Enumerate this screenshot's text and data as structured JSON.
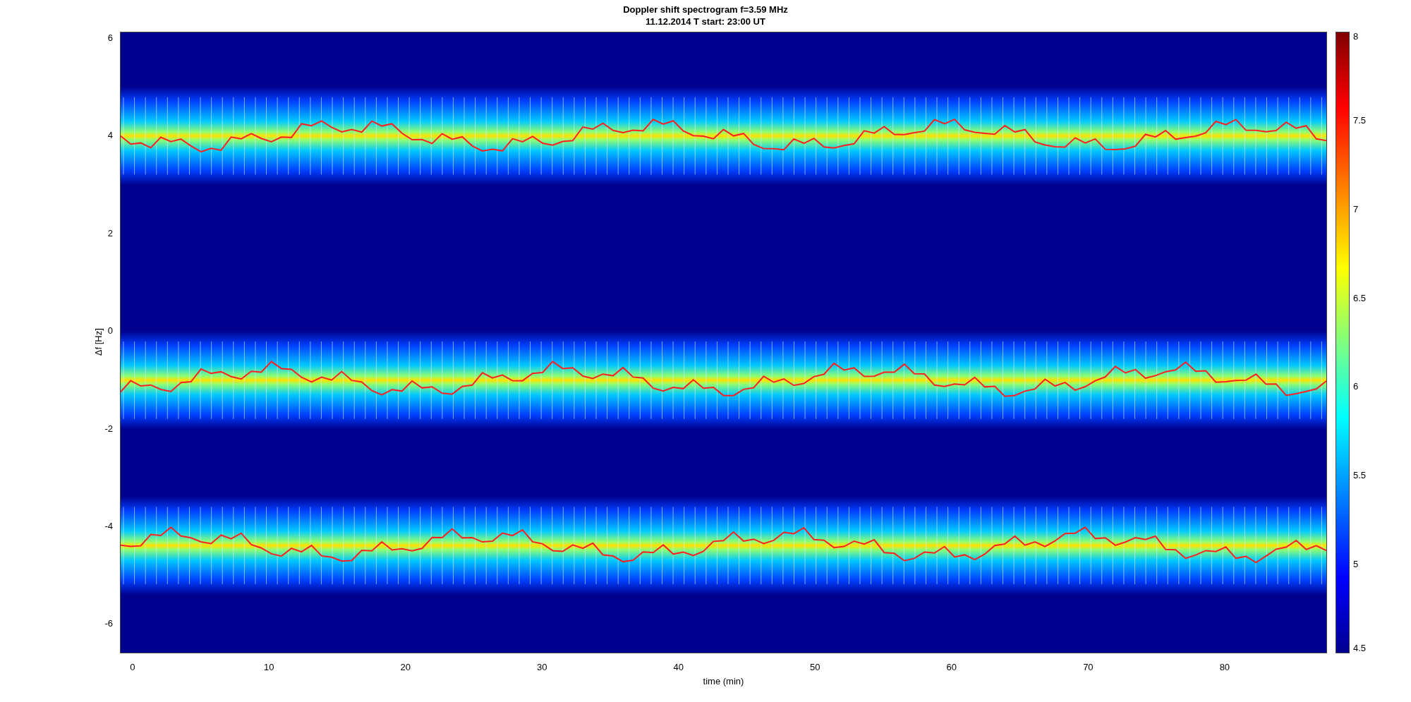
{
  "figure": {
    "title_lines": [
      "Doppler shift spectrogram f=3.59 MHz",
      "11.12.2014   T start: 23:00 UT"
    ],
    "axes": {
      "xlabel": "time (min)",
      "ylabel": "Δf [Hz]",
      "xticks": [
        "0",
        "10",
        "20",
        "30",
        "40",
        "50",
        "60",
        "70",
        "80"
      ],
      "yticks": [
        "6",
        "4",
        "2",
        "0",
        "-2",
        "-4",
        "-6"
      ]
    },
    "colorbar": {
      "ticks": [
        "8",
        "7.5",
        "7",
        "6.5",
        "6",
        "5.5",
        "5",
        "4.5"
      ]
    }
  }
}
